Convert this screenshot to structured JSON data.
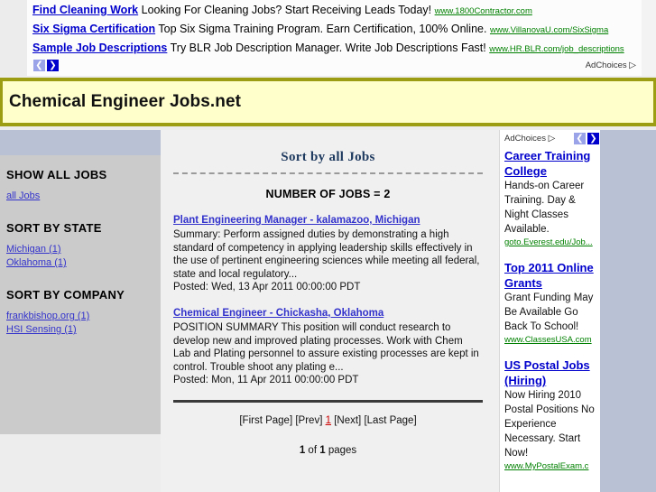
{
  "top_ads": {
    "items": [
      {
        "title": "Find Cleaning Work",
        "desc": "Looking For Cleaning Jobs? Start Receiving Leads Today!",
        "url": "www.1800Contractor.com"
      },
      {
        "title": "Six Sigma Certification",
        "desc": "Top Six Sigma Training Program. Earn Certification, 100% Online.",
        "url": "www.VillanovaU.com/SixSigma"
      },
      {
        "title": "Sample Job Descriptions",
        "desc": "Try BLR Job Description Manager. Write Job Descriptions Fast!",
        "url": "www.HR.BLR.com/job_descriptions"
      }
    ],
    "prev_arrow": "❮",
    "next_arrow": "❯",
    "adchoices_label": "AdChoices",
    "adchoices_icon": "▷"
  },
  "header": {
    "title": "Chemical Engineer Jobs.net"
  },
  "sidebar": {
    "groups": [
      {
        "heading": "SHOW ALL JOBS",
        "links": [
          "all Jobs"
        ]
      },
      {
        "heading": "SORT BY STATE",
        "links": [
          "Michigan (1)",
          "Oklahoma (1)"
        ]
      },
      {
        "heading": "SORT BY COMPANY",
        "links": [
          "frankbishop.org (1)",
          "HSI Sensing (1)"
        ]
      }
    ]
  },
  "main": {
    "sort_title": "Sort by all Jobs",
    "job_count_label": "NUMBER OF JOBS = 2",
    "jobs": [
      {
        "title": "Plant Engineering Manager - kalamazoo, Michigan",
        "summary": "Summary: Perform assigned duties by demonstrating a high standard of competency in applying leadership skills effectively in the use of pertinent engineering sciences while meeting all federal, state and local regulatory...",
        "posted": "Posted: Wed, 13 Apr 2011 00:00:00 PDT"
      },
      {
        "title": "Chemical Engineer - Chickasha, Oklahoma",
        "summary": "POSITION SUMMARY This position will conduct research to develop new and improved plating processes. Work with Chem Lab and Plating personnel to assure existing processes are kept in control. Trouble shoot any plating e...",
        "posted": "Posted: Mon, 11 Apr 2011 00:00:00 PDT"
      }
    ],
    "pager": {
      "first": "[First Page]",
      "prev": "[Prev]",
      "current": "1",
      "next": "[Next]",
      "last": "[Last Page]",
      "count_prefix": "1",
      "count_middle": " of ",
      "count_value": "1",
      "count_suffix": " pages"
    }
  },
  "right_rail": {
    "adchoices_label": "AdChoices",
    "adchoices_icon": "▷",
    "prev_arrow": "❮",
    "next_arrow": "❯",
    "ads": [
      {
        "title": "Career Training College",
        "desc": "Hands-on Career Training. Day & Night Classes Available.",
        "url": "goto.Everest.edu/Job..."
      },
      {
        "title": "Top 2011 Online Grants",
        "desc": "Grant Funding May Be Available Go Back To School!",
        "url": "www.ClassesUSA.com"
      },
      {
        "title": "US Postal Jobs (Hiring)",
        "desc": "Now Hiring 2010 Postal Positions No Experience Necessary. Start Now!",
        "url": "www.MyPostalExam.c"
      }
    ]
  },
  "colors": {
    "header_border": "#9d9d14",
    "header_bg": "#ffffcc",
    "link_blue": "#3333cc",
    "ad_blue": "#0000cc",
    "ad_green": "#008000",
    "sidebar_gray": "#cbcbcb",
    "sidebar_blue": "#b8c2d4",
    "pager_red": "#cc0000"
  }
}
